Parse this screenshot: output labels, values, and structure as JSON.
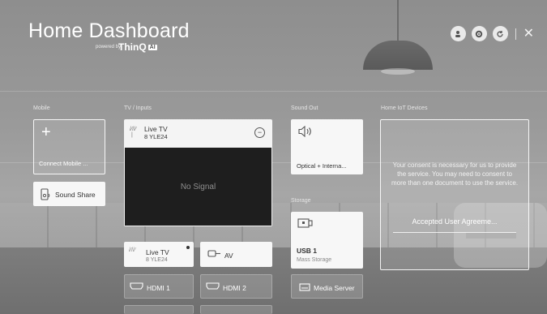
{
  "header": {
    "title": "Home Dashboard",
    "powered_by": "powered by",
    "brand": "ThinQ",
    "ai_badge": "AI"
  },
  "top_actions": [
    {
      "icon": "account-icon",
      "glyph": "♟"
    },
    {
      "icon": "settings-icon",
      "glyph": "⚙"
    },
    {
      "icon": "refresh-icon",
      "glyph": "↻"
    },
    {
      "icon": "close-icon",
      "glyph": "✕"
    }
  ],
  "sections": {
    "mobile": "Mobile",
    "tv_inputs": "TV / Inputs",
    "sound_out": "Sound Out",
    "storage": "Storage",
    "home_iot": "Home IoT Devices"
  },
  "mobile": {
    "connect_label": "Connect Mobile ...",
    "sound_share": "Sound Share"
  },
  "tv": {
    "main": {
      "name": "Live TV",
      "channel": "8 YLE24",
      "screen_text": "No Signal"
    },
    "live_tv_tile": {
      "name": "Live TV",
      "channel": "8 YLE24"
    },
    "av": "AV",
    "hdmi1": "HDMI 1",
    "hdmi2": "HDMI 2"
  },
  "sound_out": {
    "label": "Optical + Interna..."
  },
  "storage": {
    "name": "USB 1",
    "subtitle": "Mass Storage",
    "media_server": "Media Server"
  },
  "iot": {
    "consent_text": "Your consent is necessary for us to provide the service. You may need to consent to more than one document to use the service.",
    "accept_button": "Accepted User Agreeme..."
  }
}
